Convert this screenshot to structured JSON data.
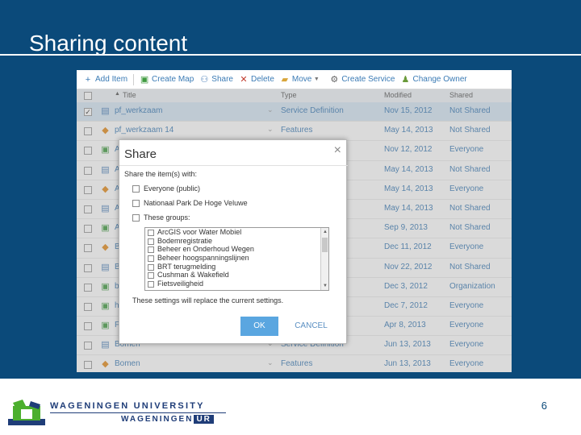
{
  "slide": {
    "title": "Sharing content",
    "page_number": "6"
  },
  "logo": {
    "line1": "WAGENINGEN UNIVERSITY",
    "line2": "WAGENINGEN",
    "line2_ur": "UR",
    "colors": {
      "green": "#4caf2e",
      "navy": "#1f3d78"
    }
  },
  "toolbar": {
    "add_item": "Add Item",
    "create_map": "Create Map",
    "share": "Share",
    "delete": "Delete",
    "move": "Move",
    "create_service": "Create Service",
    "change_owner": "Change Owner"
  },
  "table": {
    "columns": [
      "Title",
      "Type",
      "Modified",
      "Shared"
    ],
    "rows": [
      {
        "title": "pf_werkzaam",
        "type": "Service Definition",
        "modified": "Nov 15, 2012",
        "shared": "Not Shared",
        "icon": "doc-icon",
        "checked": true
      },
      {
        "title": "pf_werkzaam 14",
        "type": "Features",
        "modified": "May 14, 2013",
        "shared": "Not Shared",
        "icon": "feature-icon",
        "checked": false
      },
      {
        "title": "A",
        "type": "",
        "modified": "Nov 12, 2012",
        "shared": "Everyone",
        "icon": "map-icon",
        "checked": false
      },
      {
        "title": "A",
        "type": "",
        "modified": "May 14, 2013",
        "shared": "Not Shared",
        "icon": "doc-icon",
        "checked": false
      },
      {
        "title": "A",
        "type": "",
        "modified": "May 14, 2013",
        "shared": "Everyone",
        "icon": "feature-icon",
        "checked": false
      },
      {
        "title": "A",
        "type": "",
        "modified": "May 14, 2013",
        "shared": "Not Shared",
        "icon": "doc-icon",
        "checked": false
      },
      {
        "title": "A",
        "type": "ection",
        "modified": "Sep 9, 2013",
        "shared": "Not Shared",
        "icon": "map-icon",
        "checked": false
      },
      {
        "title": "B",
        "type": "",
        "modified": "Dec 11, 2012",
        "shared": "Everyone",
        "icon": "feature-icon",
        "checked": false
      },
      {
        "title": "B",
        "type": "",
        "modified": "Nov 22, 2012",
        "shared": "Not Shared",
        "icon": "doc-icon",
        "checked": false
      },
      {
        "title": "b",
        "type": "cation",
        "modified": "Dec 3, 2012",
        "shared": "Organization",
        "icon": "map-icon",
        "checked": false
      },
      {
        "title": "h",
        "type": "",
        "modified": "Dec 7, 2012",
        "shared": "Everyone",
        "icon": "map-icon",
        "checked": false
      },
      {
        "title": "F",
        "type": "",
        "modified": "Apr 8, 2013",
        "shared": "Everyone",
        "icon": "map-icon",
        "checked": false
      },
      {
        "title": "Bomen",
        "type": "Service Definition",
        "modified": "Jun 13, 2013",
        "shared": "Everyone",
        "icon": "doc-icon",
        "checked": false
      },
      {
        "title": "Bomen",
        "type": "Features",
        "modified": "Jun 13, 2013",
        "shared": "Everyone",
        "icon": "feature-icon",
        "checked": false
      }
    ]
  },
  "dialog": {
    "title": "Share",
    "close": "×",
    "subtitle": "Share the item(s) with:",
    "options": [
      "Everyone (public)",
      "Nationaal Park De Hoge Veluwe",
      "These groups:"
    ],
    "groups": [
      "ArcGIS voor Water Mobiel",
      "Bodemregistratie",
      "Beheer en Onderhoud Wegen",
      "Beheer hoogspanningslijnen",
      "BRT terugmelding",
      "Cushman & Wakefield",
      "Fietsveiligheid"
    ],
    "note": "These settings will replace the current settings.",
    "ok": "OK",
    "cancel": "CANCEL"
  }
}
